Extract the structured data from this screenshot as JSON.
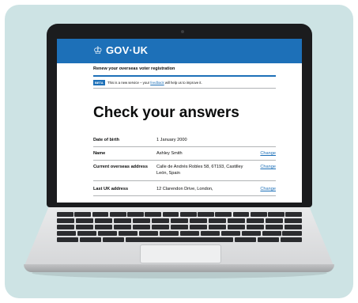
{
  "colors": {
    "panel": "#cde3e4",
    "govuk_blue": "#1d70b8",
    "text": "#0b0c0c",
    "laptop_bezel": "#1b1c1e"
  },
  "header": {
    "crown_icon": "crown-icon",
    "title": "GOV·UK"
  },
  "service": {
    "name": "Renew your overseas voter registration"
  },
  "beta": {
    "tag": "BETA",
    "text_before": "This is a new service – your ",
    "link": "feedback",
    "text_after": " will help us to improve it."
  },
  "page": {
    "title": "Check your answers"
  },
  "summary_rows": [
    {
      "key": "Date of birth",
      "value": "1 January 2000",
      "action": ""
    },
    {
      "key": "Name",
      "value": "Ashley Smith",
      "action": "Change"
    },
    {
      "key": "Current overseas address",
      "value": "Calle de Andrés Robles 58, 6T193, Castilley León, Spain",
      "action": "Change"
    },
    {
      "key": "Last UK address",
      "value": "12 Clarendon Drive, London,",
      "action": "Change"
    }
  ]
}
